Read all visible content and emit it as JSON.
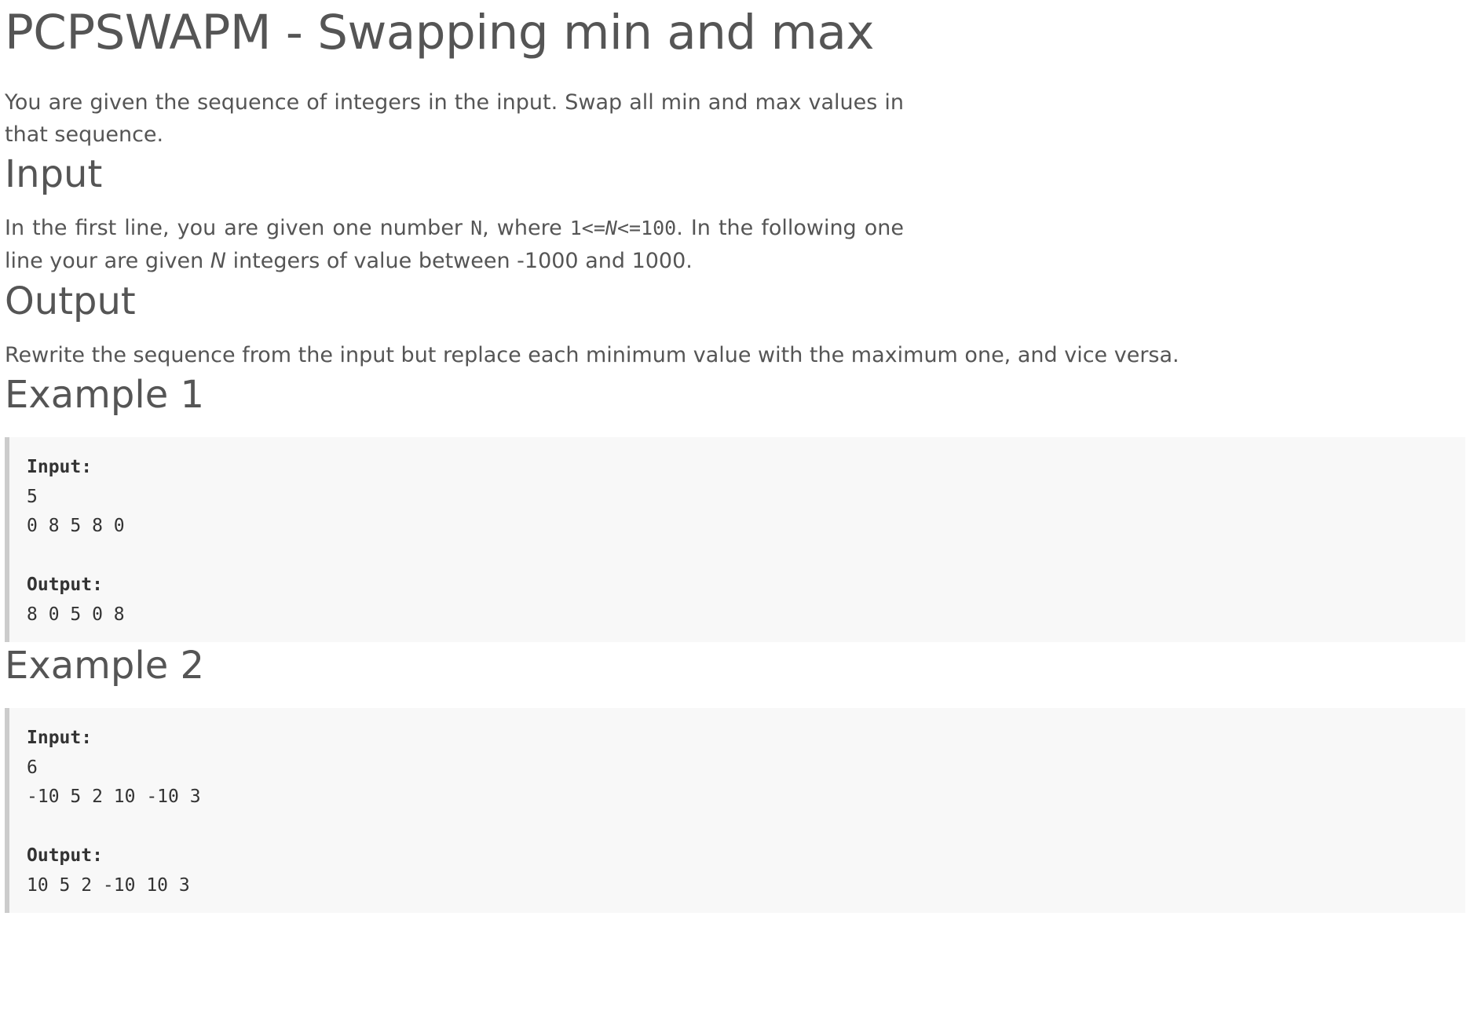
{
  "title": "PCPSWAPM - Swapping min and max",
  "intro": "You are given the sequence of integers in the input. Swap all min and max values in that sequence.",
  "input_section": {
    "heading": "Input",
    "text_part1": "In the first line, you are given one number ",
    "code_n": "N",
    "text_part2": ", where ",
    "code_range_start": "1<=",
    "code_range_var": "N",
    "code_range_end": "<=100",
    "text_part3": ". In the following one line your are given ",
    "var_n": "N",
    "text_part4": " integers of value between -1000 and 1000."
  },
  "output_section": {
    "heading": "Output",
    "text": "Rewrite the sequence from the input but replace each minimum value with the maximum one, and vice versa."
  },
  "examples": [
    {
      "heading": "Example 1",
      "input_label": "Input:",
      "input_lines": [
        "5",
        "0 8 5 8 0"
      ],
      "output_label": "Output:",
      "output_lines": [
        "8 0 5 0 8"
      ]
    },
    {
      "heading": "Example 2",
      "input_label": "Input:",
      "input_lines": [
        "6",
        "-10 5 2 10 -10 3"
      ],
      "output_label": "Output:",
      "output_lines": [
        "10 5 2 -10 10 3"
      ]
    }
  ]
}
